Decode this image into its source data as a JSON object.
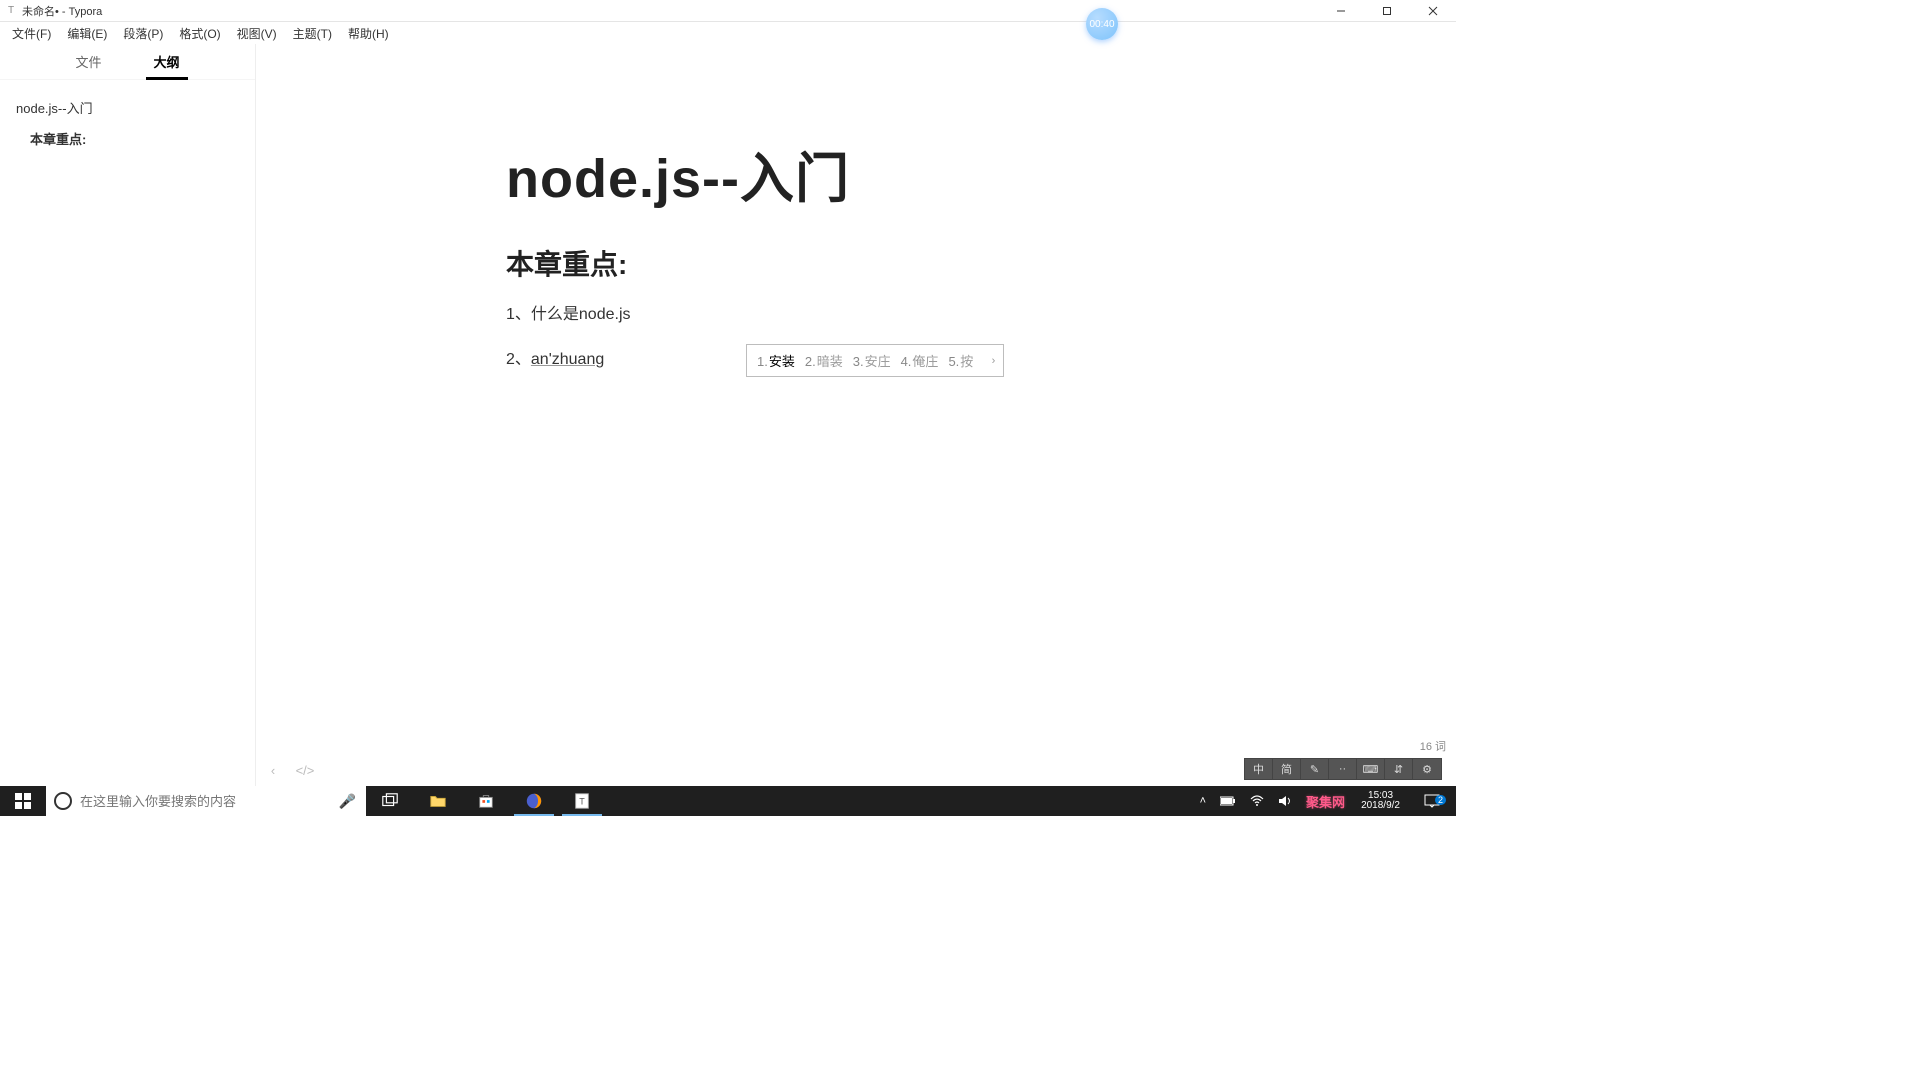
{
  "window": {
    "title": "未命名• - Typora"
  },
  "recorder": {
    "time": "00:40"
  },
  "menu": {
    "items": [
      "文件(F)",
      "编辑(E)",
      "段落(P)",
      "格式(O)",
      "视图(V)",
      "主题(T)",
      "帮助(H)"
    ]
  },
  "sidebar": {
    "tabs": {
      "files": "文件",
      "outline": "大纲"
    },
    "outline": [
      {
        "level": "h1",
        "text": "node.js--入门"
      },
      {
        "level": "h2",
        "text": "本章重点:"
      }
    ]
  },
  "doc": {
    "h1": "node.js--入门",
    "h2": "本章重点:",
    "p1": "1、什么是node.js",
    "p2_prefix": "2、",
    "p2_ime": "an'zhuang"
  },
  "ime": {
    "candidates": [
      {
        "n": "1.",
        "w": "安装"
      },
      {
        "n": "2.",
        "w": "暗装"
      },
      {
        "n": "3.",
        "w": "安庄"
      },
      {
        "n": "4.",
        "w": "俺庄"
      },
      {
        "n": "5.",
        "w": "按"
      }
    ]
  },
  "status_toolbar": {
    "items": [
      "中",
      "简",
      "✎",
      "··",
      "⌨",
      "⇵",
      "⚙"
    ]
  },
  "word_count": "16 词",
  "taskbar": {
    "search_placeholder": "在这里输入你要搜索的内容",
    "tray": {
      "watermark": "聚集网",
      "time": "15:03",
      "date": "2018/9/2",
      "notif_count": "2"
    }
  }
}
